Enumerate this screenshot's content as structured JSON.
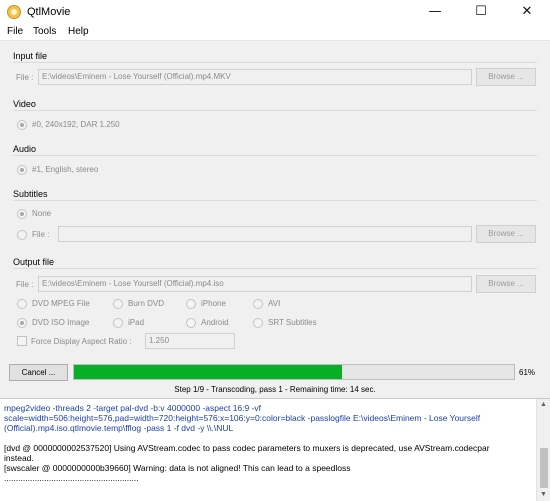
{
  "window": {
    "title": "QtlMovie"
  },
  "menu": [
    "File",
    "Tools",
    "Help"
  ],
  "input": {
    "section": "Input file",
    "label": "File :",
    "value": "E:\\videos\\Eminem - Lose Yourself (Official).mp4.MKV",
    "browse": "Browse ..."
  },
  "video": {
    "section": "Video",
    "option": "#0, 240x192, DAR 1.250"
  },
  "audio": {
    "section": "Audio",
    "option": "#1, English, stereo"
  },
  "subtitles": {
    "section": "Subtitles",
    "none": "None",
    "file_label": "File :",
    "file_value": "",
    "browse": "Browse ..."
  },
  "output": {
    "section": "Output file",
    "label": "File :",
    "value": "E:\\videos\\Eminem - Lose Yourself (Official).mp4.iso",
    "browse": "Browse ...",
    "formats": [
      "DVD MPEG File",
      "Burn DVD",
      "iPhone",
      "AVI",
      "DVD ISO Image",
      "iPad",
      "Android",
      "SRT Subtitles"
    ],
    "selected_format": "DVD ISO Image",
    "force_aspect_label": "Force Display Aspect Ratio :",
    "force_aspect_value": "1.250"
  },
  "progress": {
    "cancel": "Cancel ...",
    "percent_text": "61%",
    "percent": 61,
    "status": "Step 1/9 - Transcoding, pass 1 - Remaining time: 14 sec.",
    "color": "#06b025"
  },
  "log": {
    "lines": [
      "mpeg2video -threads 2 -target pal-dvd -b:v 4000000 -aspect 16:9 -vf",
      "scale=width=506:height=576,pad=width=720:height=576:x=106:y=0:color=black -passlogfile E:\\videos\\Eminem - Lose Yourself",
      "(Official).mp4.iso.qtlmovie.temp\\fflog -pass 1 -f dvd -y \\\\.\\NUL",
      "[dvd @ 0000000002537520] Using AVStream.codec to pass codec parameters to muxers is deprecated, use AVStream.codecpar",
      "instead.",
      "[swscaler @ 0000000000b39660] Warning: data is not aligned! This can lead to a speedloss",
      "........................................................."
    ]
  }
}
